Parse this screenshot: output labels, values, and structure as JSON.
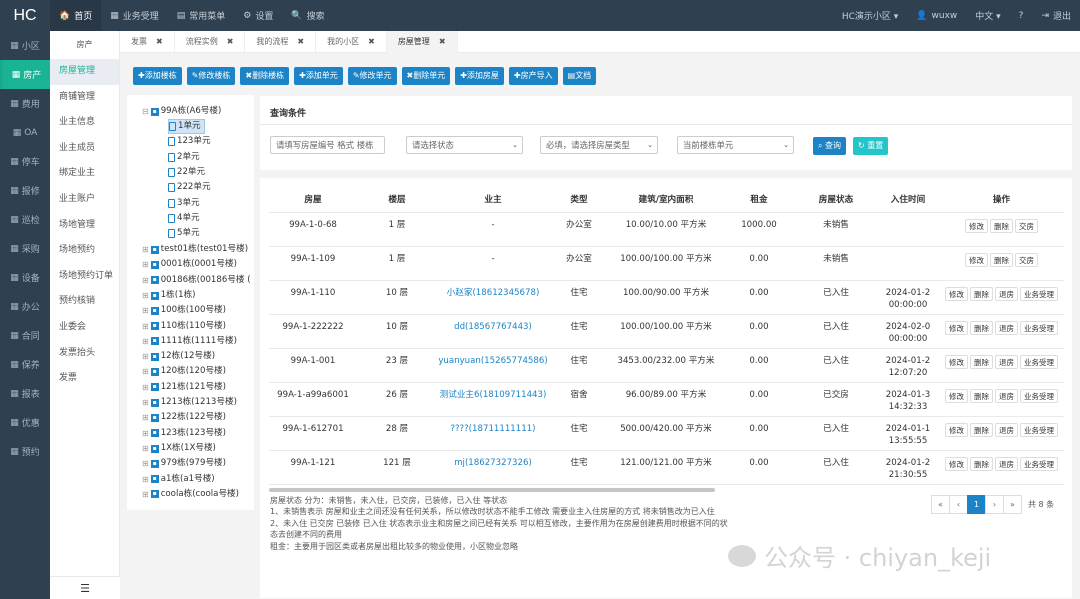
{
  "logo": "HC",
  "topnav": [
    {
      "icon": "🏠",
      "label": "首页",
      "active": true
    },
    {
      "icon": "▦",
      "label": "业务受理"
    },
    {
      "icon": "▤",
      "label": "常用菜单"
    },
    {
      "icon": "⚙",
      "label": "设置"
    },
    {
      "icon": "🔍",
      "label": "搜索"
    }
  ],
  "topright": {
    "community": "HC演示小区 ▾",
    "user": "wuxw",
    "lang": "中文 ▾",
    "help": "?",
    "logout": "退出"
  },
  "leftnav": [
    {
      "icon": "▦",
      "label": "小区"
    },
    {
      "icon": "▦",
      "label": "房产",
      "active": true
    },
    {
      "icon": "▦",
      "label": "费用"
    },
    {
      "icon": "▦",
      "label": "OA"
    },
    {
      "icon": "▦",
      "label": "停车"
    },
    {
      "icon": "▦",
      "label": "报修"
    },
    {
      "icon": "▦",
      "label": "巡检"
    },
    {
      "icon": "▦",
      "label": "采购"
    },
    {
      "icon": "▦",
      "label": "设备"
    },
    {
      "icon": "▦",
      "label": "办公"
    },
    {
      "icon": "▦",
      "label": "合同"
    },
    {
      "icon": "▦",
      "label": "保养"
    },
    {
      "icon": "▦",
      "label": "报表"
    },
    {
      "icon": "▦",
      "label": "优惠"
    },
    {
      "icon": "▦",
      "label": "预约"
    }
  ],
  "subnav": {
    "header": "房产",
    "items": [
      "房屋管理",
      "商铺管理",
      "业主信息",
      "业主成员",
      "绑定业主",
      "业主账户",
      "场地管理",
      "场地预约",
      "场地预约订单",
      "预约核销",
      "业委会",
      "发票抬头",
      "发票"
    ]
  },
  "tabs": [
    "发票",
    "流程实例",
    "我的流程",
    "我的小区",
    "房屋管理"
  ],
  "toolbar": [
    "添加楼栋",
    "修改楼栋",
    "删除楼栋",
    "添加单元",
    "修改单元",
    "删除单元",
    "添加房屋",
    "房产导入",
    "文档"
  ],
  "tree": {
    "selected_building": "99A栋(A6号楼)",
    "units": [
      "1单元",
      "123单元",
      "2单元",
      "22单元",
      "222单元",
      "3单元",
      "4单元",
      "5单元"
    ],
    "buildings": [
      "test01栋(test01号楼)",
      "0001栋(0001号楼)",
      "00186栋(00186号楼 (",
      "1栋(1栋)",
      "100栋(100号楼)",
      "110栋(110号楼)",
      "1111栋(1111号楼)",
      "12栋(12号楼)",
      "120栋(120号楼)",
      "121栋(121号楼)",
      "1213栋(1213号楼)",
      "122栋(122号楼)",
      "123栋(123号楼)",
      "1X栋(1X号楼)",
      "979栋(979号楼)",
      "a1栋(a1号楼)",
      "coola栋(coola号楼)"
    ]
  },
  "query": {
    "title": "查询条件",
    "room_placeholder": "请填写房屋编号  格式 楼栋",
    "state_select": "请选择状态",
    "type_select": "必填，请选择房屋类型",
    "unit_select": "当前楼栋单元",
    "search": "查询",
    "reset": "重置"
  },
  "table": {
    "headers": [
      "房屋",
      "楼层",
      "业主",
      "类型",
      "建筑/室内面积",
      "租金",
      "房屋状态",
      "入住时间",
      "操作"
    ],
    "rows": [
      {
        "room": "99A-1-0-68",
        "floor": "1 层",
        "owner": "-",
        "type": "办公室",
        "area": "10.00/10.00 平方米",
        "rent": "1000.00",
        "state": "未销售",
        "time": "",
        "actions": [
          "修改",
          "删除",
          "交房"
        ]
      },
      {
        "room": "99A-1-109",
        "floor": "1 层",
        "owner": "-",
        "type": "办公室",
        "area": "100.00/100.00 平方米",
        "rent": "0.00",
        "state": "未销售",
        "time": "",
        "actions": [
          "修改",
          "删除",
          "交房"
        ]
      },
      {
        "room": "99A-1-110",
        "floor": "10 层",
        "owner": "小赵家(18612345678)",
        "type": "住宅",
        "area": "100.00/90.00 平方米",
        "rent": "0.00",
        "state": "已入住",
        "time": "2024-01-2 00:00:00",
        "actions": [
          "修改",
          "删除",
          "退房",
          "业务受理"
        ]
      },
      {
        "room": "99A-1-222222",
        "floor": "10 层",
        "owner": "dd(18567767443)",
        "type": "住宅",
        "area": "100.00/100.00 平方米",
        "rent": "0.00",
        "state": "已入住",
        "time": "2024-02-0 00:00:00",
        "actions": [
          "修改",
          "删除",
          "退房",
          "业务受理"
        ]
      },
      {
        "room": "99A-1-001",
        "floor": "23 层",
        "owner": "yuanyuan(15265774586)",
        "type": "住宅",
        "area": "3453.00/232.00 平方米",
        "rent": "0.00",
        "state": "已入住",
        "time": "2024-01-2 12:07:20",
        "actions": [
          "修改",
          "删除",
          "退房",
          "业务受理"
        ]
      },
      {
        "room": "99A-1-a99a6001",
        "floor": "26 层",
        "owner": "测试业主6(18109711443)",
        "type": "宿舍",
        "area": "96.00/89.00 平方米",
        "rent": "0.00",
        "state": "已交房",
        "time": "2024-01-3 14:32:33",
        "actions": [
          "修改",
          "删除",
          "退房",
          "业务受理"
        ]
      },
      {
        "room": "99A-1-612701",
        "floor": "28 层",
        "owner": "????(18711111111)",
        "type": "住宅",
        "area": "500.00/420.00 平方米",
        "rent": "0.00",
        "state": "已入住",
        "time": "2024-01-1 13:55:55",
        "actions": [
          "修改",
          "删除",
          "退房",
          "业务受理"
        ]
      },
      {
        "room": "99A-1-121",
        "floor": "121 层",
        "owner": "mj(18627327326)",
        "type": "住宅",
        "area": "121.00/121.00 平方米",
        "rent": "0.00",
        "state": "已入住",
        "time": "2024-01-2 21:30:55",
        "actions": [
          "修改",
          "删除",
          "退房",
          "业务受理"
        ]
      }
    ]
  },
  "notes": [
    "房屋状态 分为：未销售，未入住，已交房，已装修，已入住 等状态",
    "1、未销售表示 房屋和业主之间还没有任何关系，所以修改时状态不能手工修改 需要业主入住房屋的方式 将未销售改为已入住",
    "2、未入住 已交房 已装修 已入住 状态表示业主和房屋之间已经有关系 可以相互修改，主要作用为在房屋创建费用时根据不同的状态去创建不同的费用",
    "租金：主要用于园区类或者房屋出租比较多的物业使用，小区物业忽略"
  ],
  "pager": {
    "items": [
      "«",
      "‹",
      "1",
      "›",
      "»"
    ],
    "current": "1",
    "total": "共 8 条"
  },
  "watermark": "公众号 · chiyan_keji"
}
